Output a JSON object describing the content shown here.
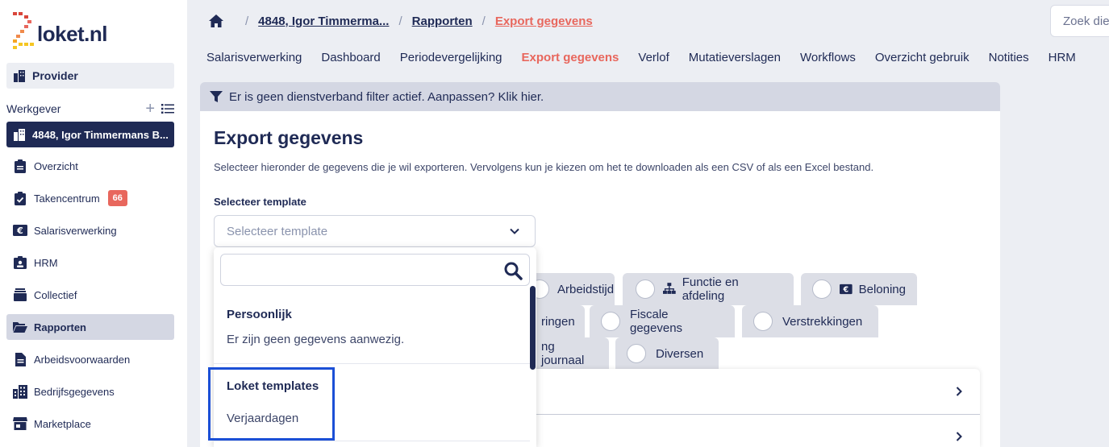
{
  "brand": {
    "logo_text": "loket.nl"
  },
  "sidebar": {
    "provider_label": "Provider",
    "werkgever_label": "Werkgever",
    "employer_name": "4848, Igor Timmermans B...",
    "items": [
      {
        "label": "Overzicht",
        "icon": "clipboard-icon"
      },
      {
        "label": "Takencentrum",
        "icon": "clipboard-check-icon",
        "badge": "66"
      },
      {
        "label": "Salarisverwerking",
        "icon": "euro-money-icon"
      },
      {
        "label": "HRM",
        "icon": "id-card-icon"
      },
      {
        "label": "Collectief",
        "icon": "layers-icon"
      },
      {
        "label": "Rapporten",
        "icon": "folder-open-icon",
        "active": true
      },
      {
        "label": "Arbeidsvoorwaarden",
        "icon": "document-icon"
      },
      {
        "label": "Bedrijfsgegevens",
        "icon": "buildings-icon"
      },
      {
        "label": "Marketplace",
        "icon": "store-icon"
      }
    ]
  },
  "breadcrumb": {
    "items": [
      "4848, Igor Timmerma...",
      "Rapporten"
    ],
    "current": "Export gegevens"
  },
  "search": {
    "placeholder": "Zoek die"
  },
  "tabs": [
    {
      "label": "Salarisverwerking"
    },
    {
      "label": "Dashboard"
    },
    {
      "label": "Periodevergelijking"
    },
    {
      "label": "Export gegevens",
      "active": true
    },
    {
      "label": "Verlof"
    },
    {
      "label": "Mutatieverslagen"
    },
    {
      "label": "Workflows"
    },
    {
      "label": "Overzicht gebruik"
    },
    {
      "label": "Notities"
    },
    {
      "label": "HRM"
    }
  ],
  "filter_bar": {
    "text": "Er is geen dienstverband filter actief. Aanpassen? Klik hier."
  },
  "card": {
    "title": "Export gegevens",
    "description": "Selecteer hieronder de gegevens die je wil exporteren. Vervolgens kun je kiezen om het te downloaden als een CSV of als een Excel bestand.",
    "template_label": "Selecteer template",
    "template_placeholder": "Selecteer template"
  },
  "chips": {
    "arbeidstijd": "Arbeidstijd",
    "functie": "Functie en afdeling",
    "beloning": "Beloning",
    "ringen": "ringen",
    "fiscale": "Fiscale gegevens",
    "verstrekkingen": "Verstrekkingen",
    "journaal": "ng journaal",
    "diversen": "Diversen"
  },
  "dropdown": {
    "group_personal": "Persoonlijk",
    "empty_text": "Er zijn geen gegevens aanwezig.",
    "group_loket": "Loket templates",
    "option_verjaardagen": "Verjaardagen"
  },
  "colors": {
    "navy": "#1f2a55",
    "accent": "#e8675d",
    "highlight": "#1b4fd6"
  }
}
